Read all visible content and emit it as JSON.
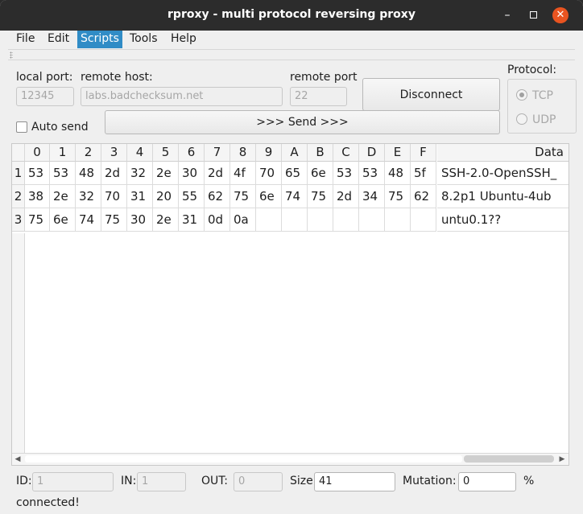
{
  "window": {
    "title": "rproxy - multi protocol reversing proxy",
    "close_color": "#e95420"
  },
  "menu": {
    "items": [
      "File",
      "Edit",
      "Scripts",
      "Tools",
      "Help"
    ],
    "active": "Scripts",
    "active_color": "#308cc6"
  },
  "connection": {
    "local_port_label": "local port:",
    "local_port_value": "12345",
    "remote_host_label": "remote host:",
    "remote_host_value": "labs.badchecksum.net",
    "remote_port_label": "remote port",
    "remote_port_value": "22",
    "disconnect_label": "Disconnect",
    "auto_send_label": "Auto send",
    "auto_send_checked": false,
    "send_label": ">>> Send >>>"
  },
  "protocol": {
    "label": "Protocol:",
    "options": [
      "TCP",
      "UDP"
    ],
    "selected": "TCP"
  },
  "hex_table": {
    "columns": [
      "0",
      "1",
      "2",
      "3",
      "4",
      "5",
      "6",
      "7",
      "8",
      "9",
      "A",
      "B",
      "C",
      "D",
      "E",
      "F"
    ],
    "data_header": "Data",
    "rows": [
      {
        "index": "1",
        "bytes": [
          "53",
          "53",
          "48",
          "2d",
          "32",
          "2e",
          "30",
          "2d",
          "4f",
          "70",
          "65",
          "6e",
          "53",
          "53",
          "48",
          "5f"
        ],
        "data": "SSH-2.0-OpenSSH_"
      },
      {
        "index": "2",
        "bytes": [
          "38",
          "2e",
          "32",
          "70",
          "31",
          "20",
          "55",
          "62",
          "75",
          "6e",
          "74",
          "75",
          "2d",
          "34",
          "75",
          "62"
        ],
        "data": "8.2p1 Ubuntu-4ub"
      },
      {
        "index": "3",
        "bytes": [
          "75",
          "6e",
          "74",
          "75",
          "30",
          "2e",
          "31",
          "0d",
          "0a",
          "",
          "",
          "",
          "",
          "",
          "",
          ""
        ],
        "data": "untu0.1??"
      }
    ]
  },
  "footer": {
    "id_label": "ID:",
    "id_value": "1",
    "in_label": "IN:",
    "in_value": "1",
    "out_label": "OUT:",
    "out_value": "0",
    "size_label": "Size:",
    "size_value": "41",
    "mutation_label": "Mutation:",
    "mutation_value": "0",
    "percent_label": "%",
    "status_text": "connected!"
  }
}
